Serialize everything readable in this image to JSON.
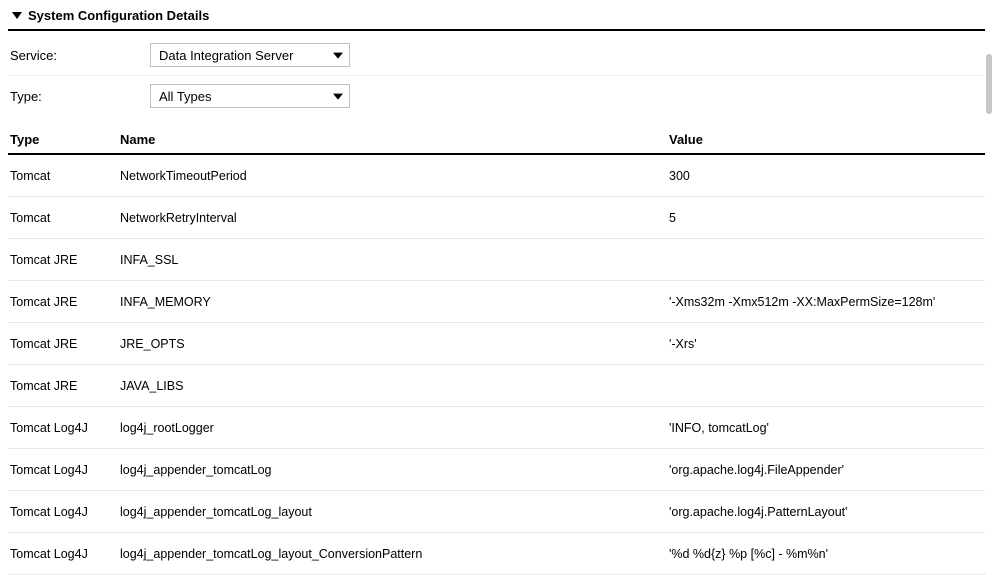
{
  "section_title": "System Configuration Details",
  "filters": {
    "service": {
      "label": "Service:",
      "selected": "Data Integration Server"
    },
    "type": {
      "label": "Type:",
      "selected": "All Types"
    }
  },
  "columns": {
    "type": "Type",
    "name": "Name",
    "value": "Value"
  },
  "rows": [
    {
      "type": "Tomcat",
      "name": "NetworkTimeoutPeriod",
      "value": "300"
    },
    {
      "type": "Tomcat",
      "name": "NetworkRetryInterval",
      "value": "5"
    },
    {
      "type": "Tomcat JRE",
      "name": "INFA_SSL",
      "value": ""
    },
    {
      "type": "Tomcat JRE",
      "name": "INFA_MEMORY",
      "value": "'-Xms32m -Xmx512m -XX:MaxPermSize=128m'"
    },
    {
      "type": "Tomcat JRE",
      "name": "JRE_OPTS",
      "value": "'-Xrs'"
    },
    {
      "type": "Tomcat JRE",
      "name": "JAVA_LIBS",
      "value": ""
    },
    {
      "type": "Tomcat Log4J",
      "name": "log4j_rootLogger",
      "value": "'INFO, tomcatLog'"
    },
    {
      "type": "Tomcat Log4J",
      "name": "log4j_appender_tomcatLog",
      "value": "'org.apache.log4j.FileAppender'"
    },
    {
      "type": "Tomcat Log4J",
      "name": "log4j_appender_tomcatLog_layout",
      "value": "'org.apache.log4j.PatternLayout'"
    },
    {
      "type": "Tomcat Log4J",
      "name": "log4j_appender_tomcatLog_layout_ConversionPattern",
      "value": "'%d %d{z} %p [%c] - %m%n'"
    }
  ]
}
